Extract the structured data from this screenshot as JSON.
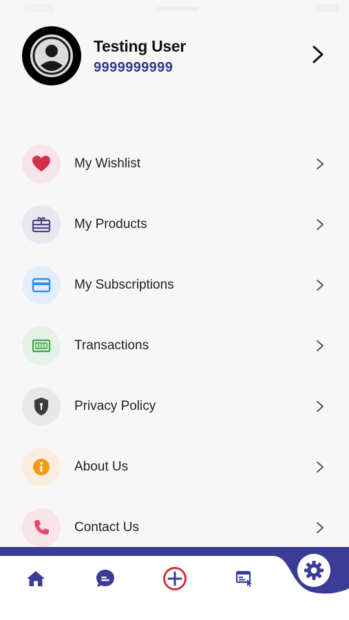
{
  "profile": {
    "name": "Testing User",
    "phone": "9999999999"
  },
  "menu": {
    "items": [
      {
        "label": "My Wishlist",
        "icon": "heart-icon",
        "icon_color": "#d32f4a",
        "bg_color": "#f7e4e8"
      },
      {
        "label": "My Products",
        "icon": "gift-card-icon",
        "icon_color": "#4a4780",
        "bg_color": "#e9e8ef"
      },
      {
        "label": "My Subscriptions",
        "icon": "credit-card-icon",
        "icon_color": "#2f8ff0",
        "bg_color": "#e4eefb"
      },
      {
        "label": "Transactions",
        "icon": "cash-icon",
        "icon_color": "#3aa64a",
        "bg_color": "#e5f2e6"
      },
      {
        "label": "Privacy Policy",
        "icon": "shield-icon",
        "icon_color": "#3d3d3d",
        "bg_color": "#e8e8e9"
      },
      {
        "label": "About Us",
        "icon": "info-icon",
        "icon_color": "#f39c12",
        "bg_color": "#fbeede"
      },
      {
        "label": "Contact Us",
        "icon": "phone-icon",
        "icon_color": "#e04d6c",
        "bg_color": "#f9e4ea"
      }
    ]
  },
  "bottom_nav": {
    "accent": "#3a3c96",
    "add_color": "#d32f3f",
    "items": [
      "home-icon",
      "chat-icon",
      "add-icon",
      "orders-icon",
      "settings-icon"
    ]
  }
}
